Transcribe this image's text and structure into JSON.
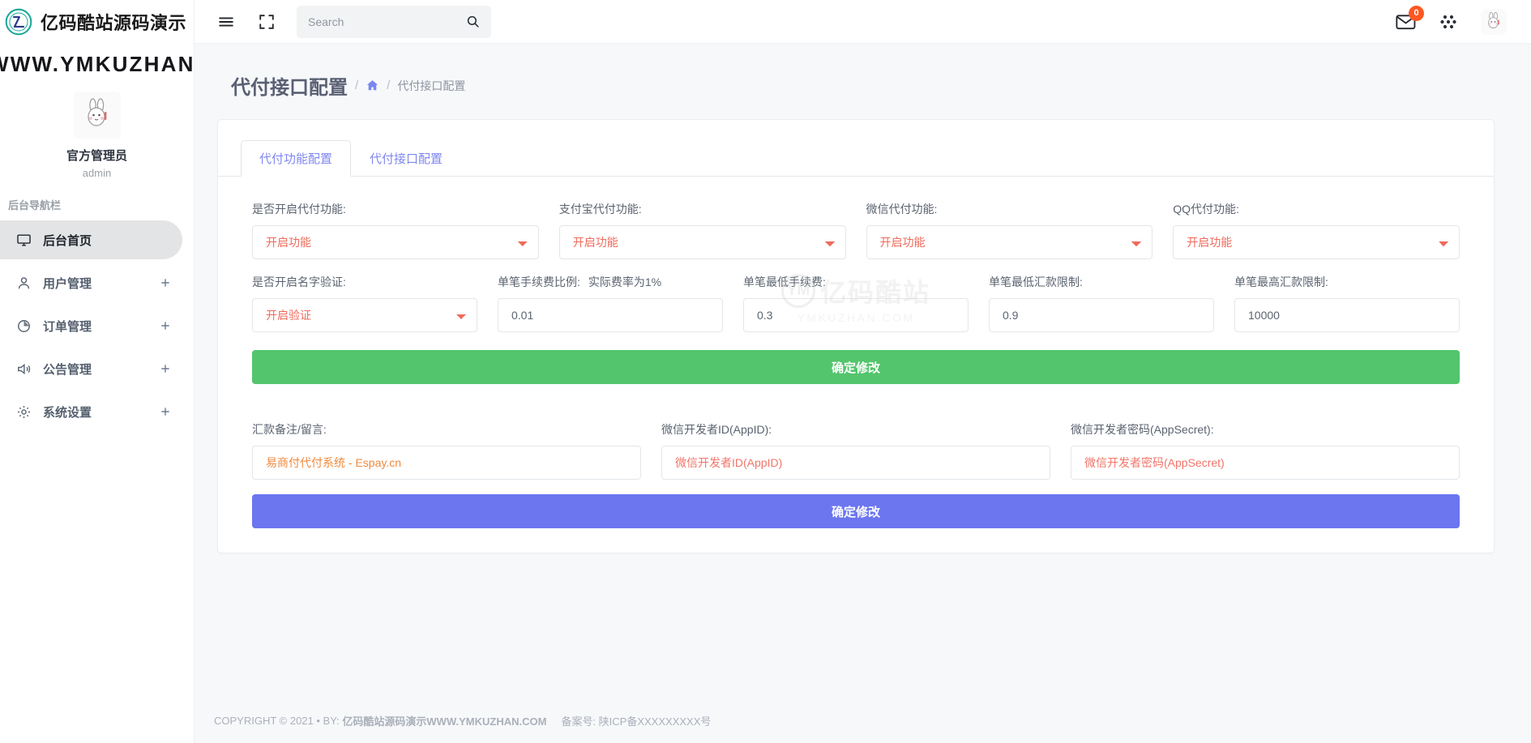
{
  "sidebar": {
    "brand_name": "亿码酷站源码演示",
    "brand_url": "WWW.YMKUZHAN.COM",
    "profile_name": "官方管理员",
    "profile_role": "admin",
    "nav_title": "后台导航栏",
    "items": [
      {
        "label": "后台首页",
        "icon": "monitor-icon",
        "active": true,
        "expandable": false
      },
      {
        "label": "用户管理",
        "icon": "user-icon",
        "active": false,
        "expandable": true
      },
      {
        "label": "订单管理",
        "icon": "pie-chart-icon",
        "active": false,
        "expandable": true
      },
      {
        "label": "公告管理",
        "icon": "speaker-icon",
        "active": false,
        "expandable": true
      },
      {
        "label": "系统设置",
        "icon": "gear-icon",
        "active": false,
        "expandable": true
      }
    ]
  },
  "topbar": {
    "menu_icon": "hamburger-icon",
    "fullscreen_icon": "fullscreen-icon",
    "search_placeholder": "Search",
    "search_value": "",
    "search_icon": "search-icon",
    "mail_icon": "mail-icon",
    "mail_badge": "0",
    "apps_icon": "apps-grid-icon",
    "avatar_icon": "avatar"
  },
  "page": {
    "title": "代付接口配置",
    "breadcrumb_sep": "/",
    "breadcrumb_home_icon": "home-icon",
    "breadcrumb_current": "代付接口配置"
  },
  "tabs": [
    {
      "label": "代付功能配置",
      "active": true
    },
    {
      "label": "代付接口配置",
      "active": false
    }
  ],
  "form": {
    "row1": [
      {
        "label": "是否开启代付功能:",
        "value": "开启功能"
      },
      {
        "label": "支付宝代付功能:",
        "value": "开启功能"
      },
      {
        "label": "微信代付功能:",
        "value": "开启功能"
      },
      {
        "label": "QQ代付功能:",
        "value": "开启功能"
      }
    ],
    "row2_select": {
      "label": "是否开启名字验证:",
      "value": "开启验证"
    },
    "row2_inputs": [
      {
        "label": "单笔手续费比例:",
        "hint": "实际费率为1%",
        "value": "0.01"
      },
      {
        "label": "单笔最低手续费:",
        "hint": "",
        "value": "0.3"
      },
      {
        "label": "单笔最低汇款限制:",
        "hint": "",
        "value": "0.9"
      },
      {
        "label": "单笔最高汇款限制:",
        "hint": "",
        "value": "10000"
      }
    ],
    "submit_green": "确定修改",
    "row3": [
      {
        "label": "汇款备注/留言:",
        "value": "易商付代付系统 - Espay.cn",
        "placeholder": ""
      },
      {
        "label": "微信开发者ID(AppID):",
        "value": "",
        "placeholder": "微信开发者ID(AppID)"
      },
      {
        "label": "微信开发者密码(AppSecret):",
        "value": "",
        "placeholder": "微信开发者密码(AppSecret)"
      }
    ],
    "submit_purple": "确定修改"
  },
  "watermark": {
    "mark": "YM",
    "cn": "亿码酷站",
    "en": "YMKUZHAN.COM"
  },
  "footer": {
    "copyright": "COPYRIGHT © 2021  •  BY:",
    "site": "亿码酷站源码演示WWW.YMKUZHAN.COM",
    "icp": "备案号: 陕ICP备XXXXXXXXX号"
  },
  "colors": {
    "accent_purple": "#6b76ef",
    "accent_green": "#53c56c",
    "accent_red": "#ef6a5b",
    "accent_orange": "#f08a3c",
    "badge_orange": "#ff5722"
  }
}
